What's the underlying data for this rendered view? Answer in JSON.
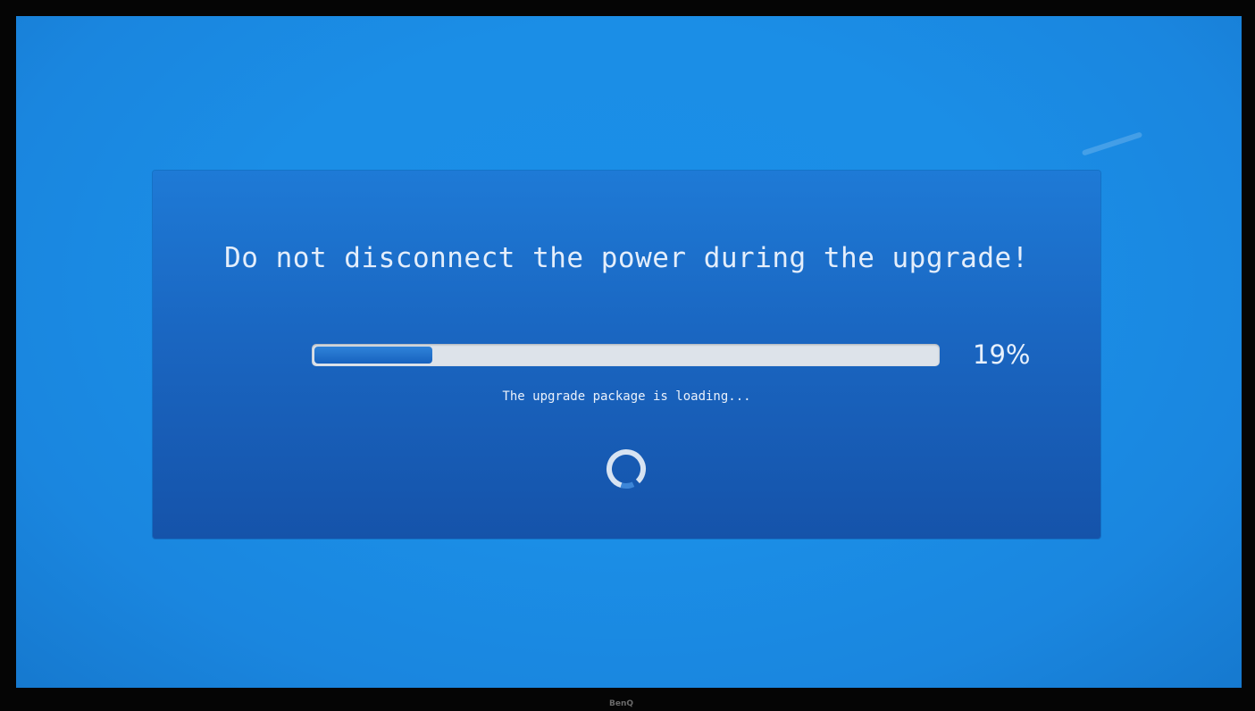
{
  "dialog": {
    "warning_text": "Do not disconnect the power during the upgrade!",
    "progress_percent": 19,
    "progress_label": "19%",
    "status_text": "The upgrade package is loading..."
  },
  "icons": {
    "spinner": "loading-spinner-icon"
  },
  "colors": {
    "screen_background": "#1a8fe8",
    "dialog_background": "#1a66c1",
    "progress_fill": "#1762bf",
    "progress_track": "#dde3ea",
    "text": "#e4eefb"
  },
  "device": {
    "brand": "BenQ"
  }
}
